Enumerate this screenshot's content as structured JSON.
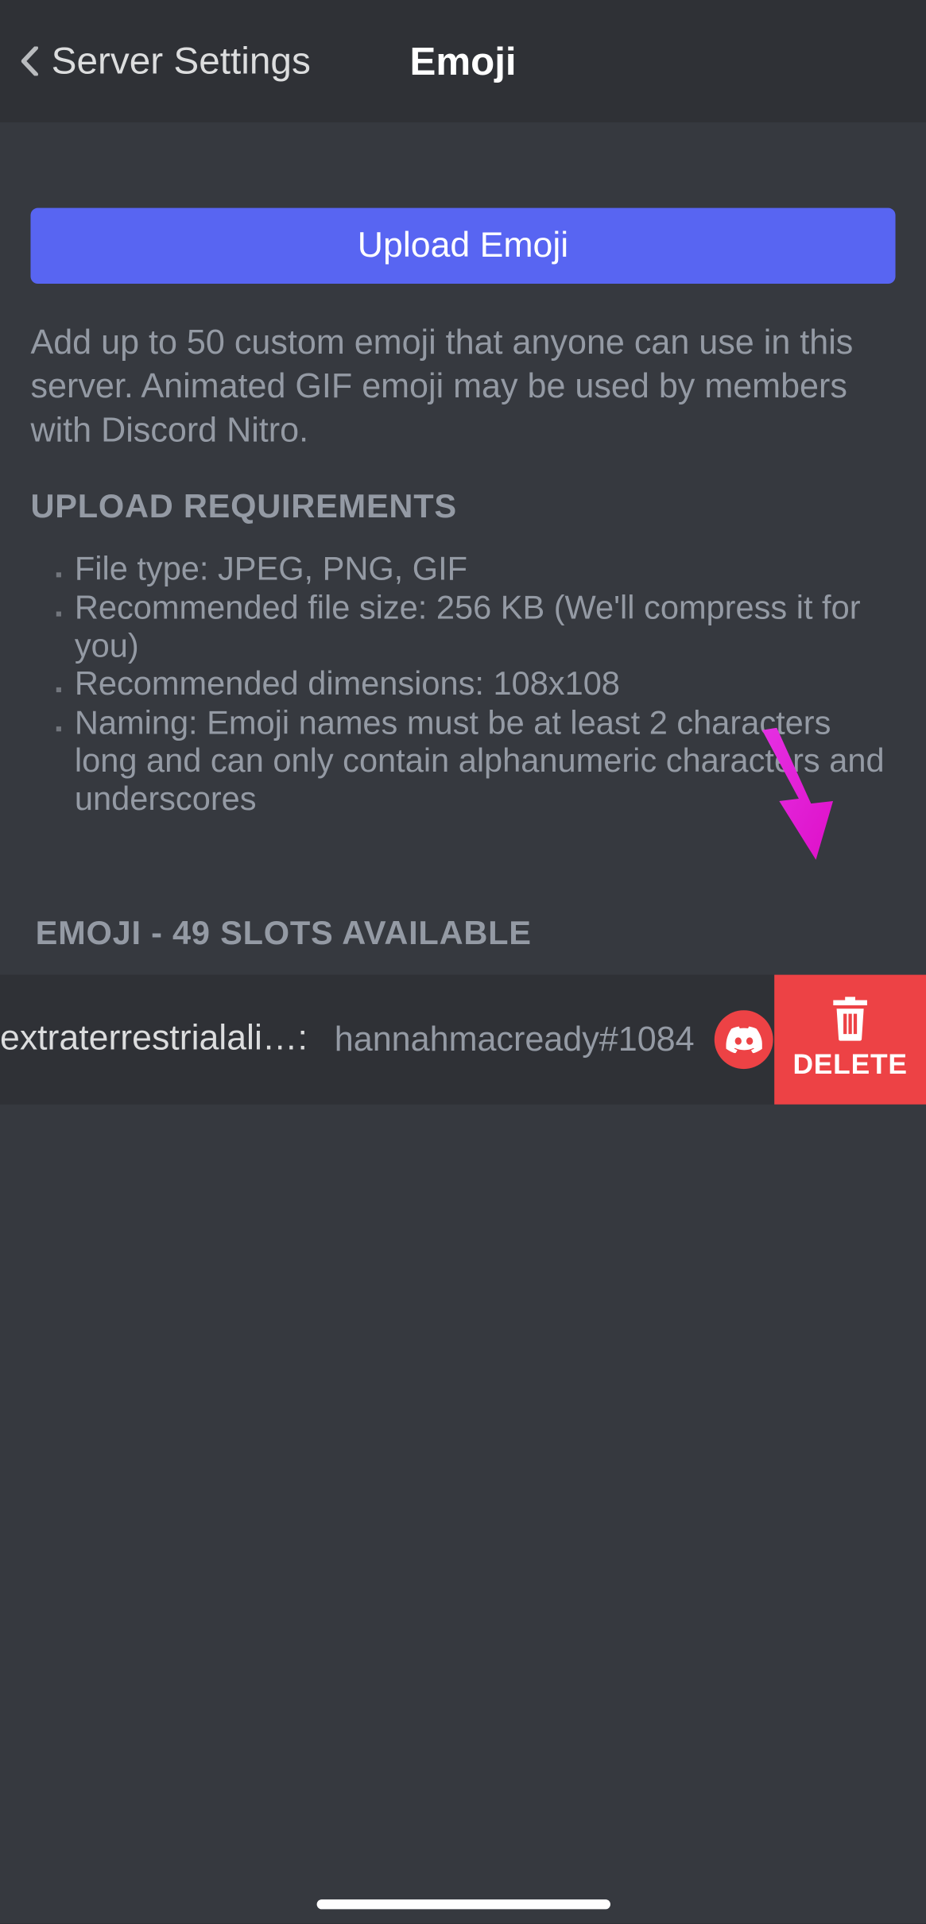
{
  "header": {
    "back_label": "Server Settings",
    "title": "Emoji"
  },
  "main": {
    "upload_button_label": "Upload Emoji",
    "description": "Add up to 50 custom emoji that anyone can use in this server. Animated GIF emoji may be used by members with Discord Nitro.",
    "requirements_heading": "UPLOAD REQUIREMENTS",
    "requirements": [
      "File type: JPEG, PNG, GIF",
      "Recommended file size: 256 KB (We'll compress it for you)",
      "Recommended dimensions: 108x108",
      "Naming: Emoji names must be at least 2 characters long and can only contain alphanumeric characters and underscores"
    ],
    "slots_heading": "EMOJI - 49 SLOTS AVAILABLE"
  },
  "emoji_list": [
    {
      "name": "extraterrestrialali…",
      "uploader": "hannahmacready#1084",
      "avatar_icon": "discord-icon",
      "delete_label": "DELETE"
    }
  ],
  "colors": {
    "accent": "#5865f2",
    "danger": "#ed4245",
    "annotation_arrow": "#e01fcf"
  }
}
